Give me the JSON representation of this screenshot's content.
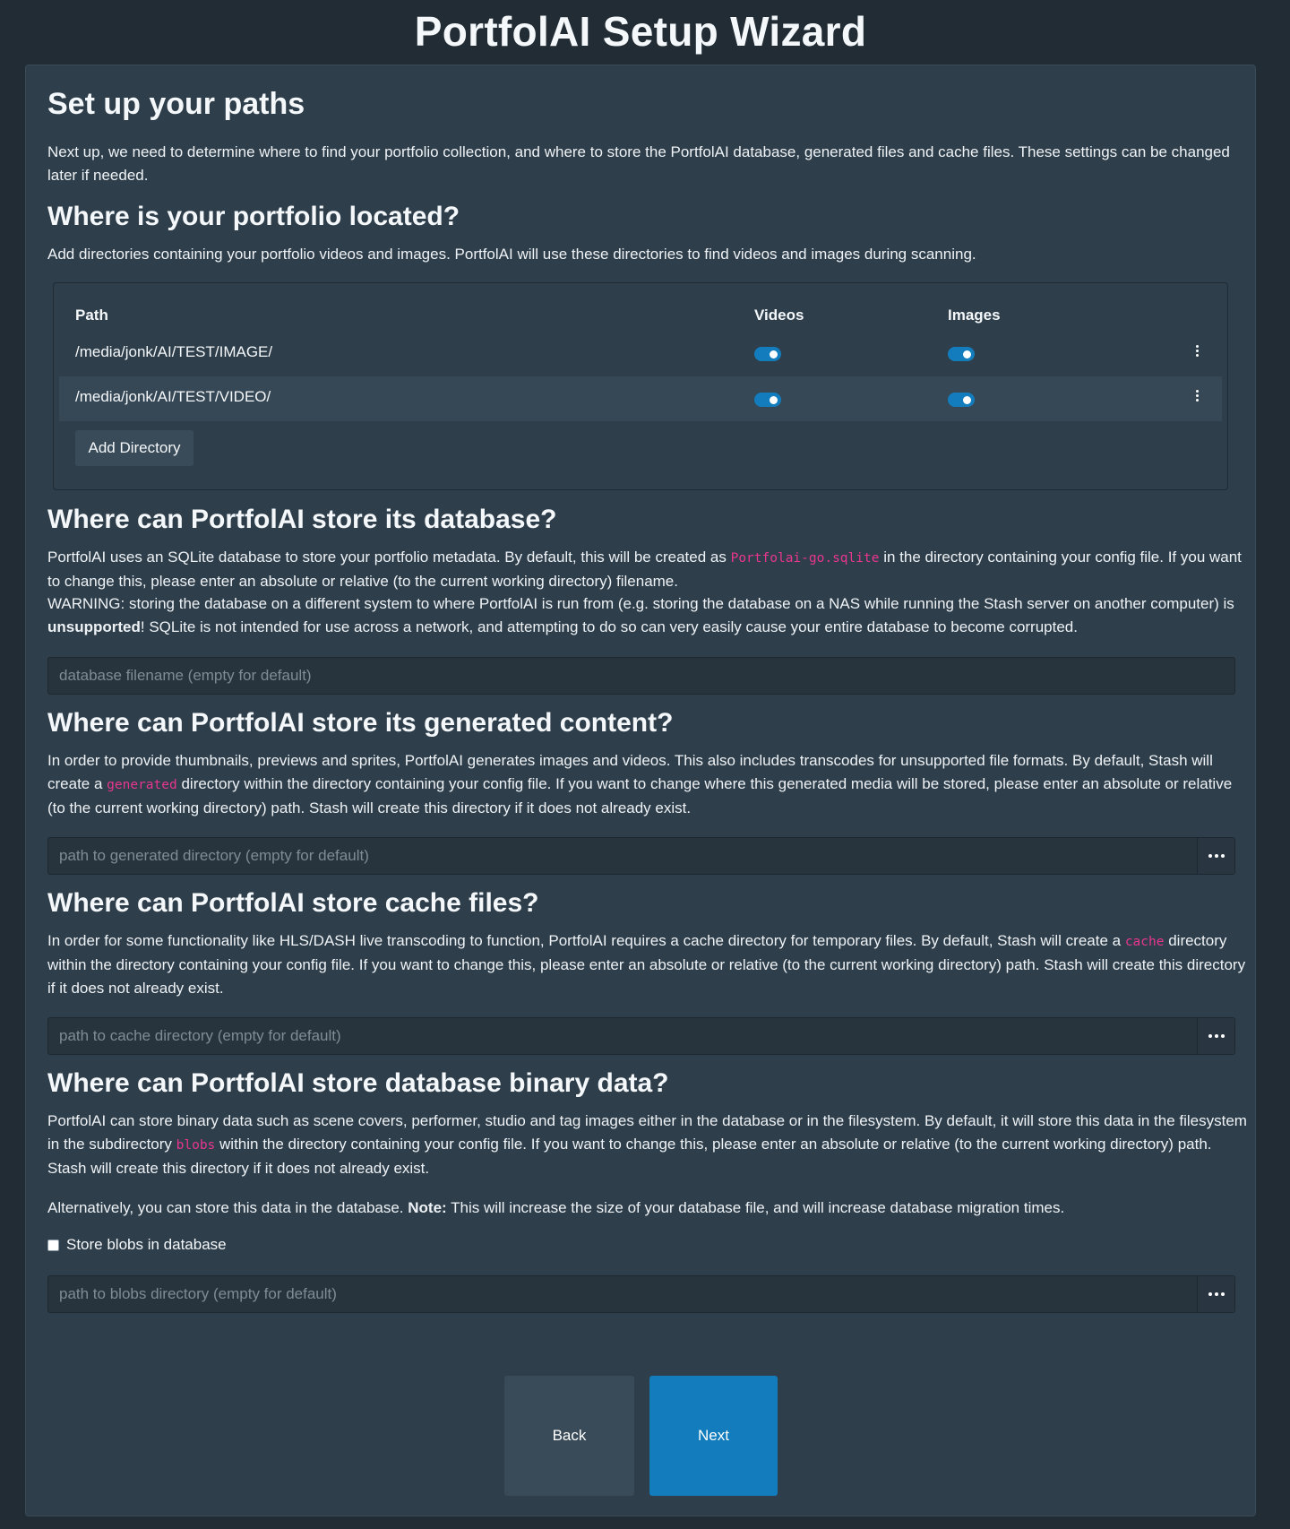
{
  "window": {
    "title": "PortfolAI Setup Wizard"
  },
  "intro": {
    "heading": "Set up your paths",
    "text": "Next up, we need to determine where to find your portfolio collection, and where to store the PortfolAI database, generated files and cache files. These settings can be changed later if needed."
  },
  "portfolio": {
    "heading": "Where is your portfolio located?",
    "text": "Add directories containing your portfolio videos and images. PortfolAI will use these directories to find videos and images during scanning.",
    "columns": {
      "path": "Path",
      "videos": "Videos",
      "images": "Images"
    },
    "rows": [
      {
        "path": "/media/jonk/AI/TEST/IMAGE/",
        "videos": true,
        "images": true
      },
      {
        "path": "/media/jonk/AI/TEST/VIDEO/",
        "videos": true,
        "images": true
      }
    ],
    "add_button": "Add Directory"
  },
  "database": {
    "heading": "Where can PortfolAI store its database?",
    "text_a": "PortfolAI uses an SQLite database to store your portfolio metadata. By default, this will be created as ",
    "code": "Portfolai-go.sqlite",
    "text_b": " in the directory containing your config file. If you want to change this, please enter an absolute or relative (to the current working directory) filename.",
    "warning_a": "WARNING: storing the database on a different system to where PortfolAI is run from (e.g. storing the database on a NAS while running the Stash server on another computer) is ",
    "warning_bold": "unsupported",
    "warning_b": "! SQLite is not intended for use across a network, and attempting to do so can very easily cause your entire database to become corrupted.",
    "placeholder": "database filename (empty for default)",
    "value": ""
  },
  "generated": {
    "heading": "Where can PortfolAI store its generated content?",
    "text_a": "In order to provide thumbnails, previews and sprites, PortfolAI generates images and videos. This also includes transcodes for unsupported file formats. By default, Stash will create a ",
    "code": "generated",
    "text_b": " directory within the directory containing your config file. If you want to change where this generated media will be stored, please enter an absolute or relative (to the current working directory) path. Stash will create this directory if it does not already exist.",
    "placeholder": "path to generated directory (empty for default)",
    "value": ""
  },
  "cache": {
    "heading": "Where can PortfolAI store cache files?",
    "text_a": "In order for some functionality like HLS/DASH live transcoding to function, PortfolAI requires a cache directory for temporary files. By default, Stash will create a ",
    "code": "cache",
    "text_b": " directory within the directory containing your config file. If you want to change this, please enter an absolute or relative (to the current working directory) path. Stash will create this directory if it does not already exist.",
    "placeholder": "path to cache directory (empty for default)",
    "value": ""
  },
  "blobs": {
    "heading": "Where can PortfolAI store database binary data?",
    "text_a": "PortfolAI can store binary data such as scene covers, performer, studio and tag images either in the database or in the filesystem. By default, it will store this data in the filesystem in the subdirectory ",
    "code": "blobs",
    "text_b": " within the directory containing your config file. If you want to change this, please enter an absolute or relative (to the current working directory) path. Stash will create this directory if it does not already exist.",
    "alt_a": "Alternatively, you can store this data in the database. ",
    "alt_bold": "Note:",
    "alt_b": " This will increase the size of your database file, and will increase database migration times.",
    "checkbox_label": "Store blobs in database",
    "checkbox_checked": false,
    "placeholder": "path to blobs directory (empty for default)",
    "value": ""
  },
  "nav": {
    "back": "Back",
    "next": "Next"
  },
  "colors": {
    "accent": "#137cbd",
    "code": "#e8368f",
    "background": "#212c35",
    "panel": "#2e3e4b"
  }
}
